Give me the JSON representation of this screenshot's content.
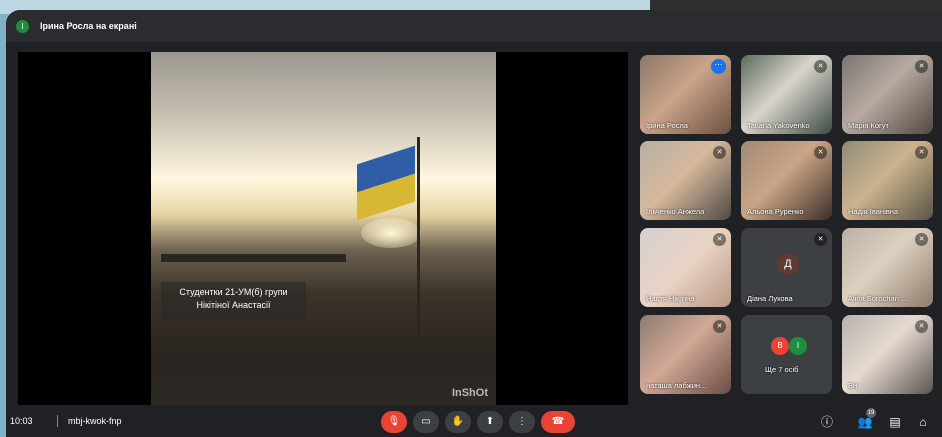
{
  "presenter": {
    "initial": "І",
    "label": "Ірина Росла на екрані"
  },
  "video": {
    "caption_line1": "Студентки 21-УМ(б) групи",
    "caption_line2": "Нікітіної Анастасії",
    "watermark": "InShOt"
  },
  "tiles": [
    {
      "name": "Ірина Росла",
      "more": "⋯"
    },
    {
      "name": "Tatiana Yakovenko",
      "mic": "✕"
    },
    {
      "name": "Марія Когут",
      "mic": "✕"
    },
    {
      "name": "Ільченко Анжела",
      "mic": "✕"
    },
    {
      "name": "Альона Руренко",
      "mic": "✕"
    },
    {
      "name": "Надія Іванівна",
      "mic": "✕"
    },
    {
      "name": "Настя Нікітіна",
      "mic": "✕"
    },
    {
      "name": "Діана Лукова",
      "mic": "✕",
      "initial": "Д"
    },
    {
      "name": "Aliña Sorochan ...",
      "mic": "✕"
    },
    {
      "name": "наташа лабжин...",
      "mic": "✕"
    },
    {
      "name": "Ще 7 осіб",
      "chip1": "В",
      "chip2": "І"
    },
    {
      "name": "Ви",
      "mic": "✕"
    }
  ],
  "bottom": {
    "time": "10:03",
    "meeting_code": "mbj-kwok-fnp",
    "participants_count": "19"
  },
  "icons": {
    "mic": "🎙",
    "camera": "▭",
    "hand": "✋",
    "present": "⬆",
    "more": "⋮",
    "end": "☎",
    "info": "ⓘ",
    "people": "👥",
    "chat": "▤",
    "activities": "⌂"
  },
  "colors": {
    "end_call": "#ea4335",
    "mic_off": "#ea4335",
    "accent": "#8ab4f8"
  }
}
